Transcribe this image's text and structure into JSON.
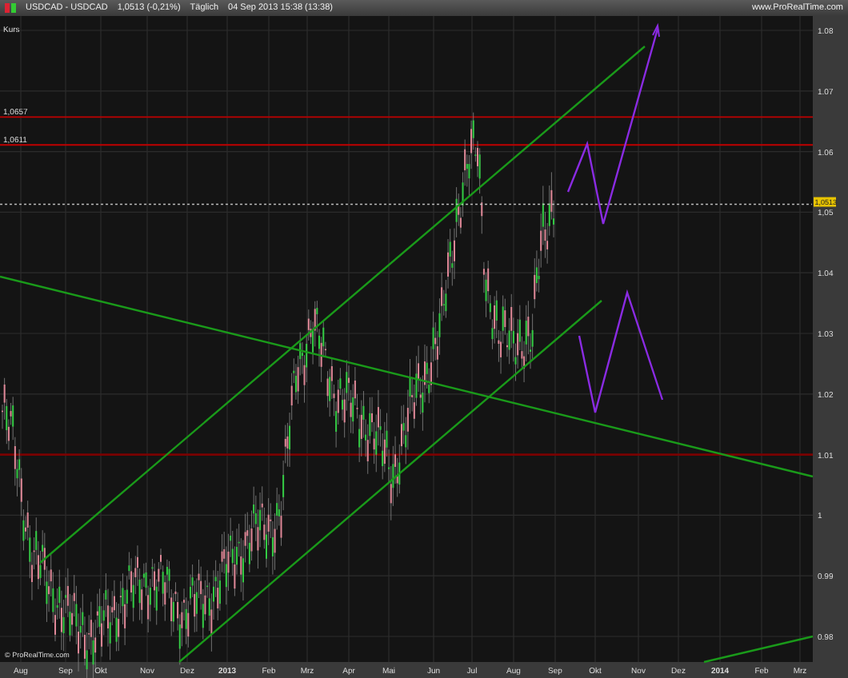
{
  "header": {
    "symbol": "USDCAD - USDCAD",
    "quote": "1,0513 (-0,21%)",
    "period": "Täglich",
    "datetime": "04 Sep 2013 15:38 (13:38)",
    "site": "www.ProRealTime.com"
  },
  "chart": {
    "unit_label": "Kurs",
    "copyright": "© ProRealTime.com",
    "price_tag": "1,0513",
    "levels": [
      {
        "label": "1,0657"
      },
      {
        "label": "1,0611"
      }
    ],
    "y_ticks": [
      {
        "label": "1.08"
      },
      {
        "label": "1.07"
      },
      {
        "label": "1.06"
      },
      {
        "label": "1,05"
      },
      {
        "label": "1.04"
      },
      {
        "label": "1.03"
      },
      {
        "label": "1.02"
      },
      {
        "label": "1.01"
      },
      {
        "label": "1"
      },
      {
        "label": "0.99"
      },
      {
        "label": "0.98"
      }
    ],
    "x_ticks": [
      {
        "label": "Aug",
        "bold": false
      },
      {
        "label": "Sep",
        "bold": false
      },
      {
        "label": "Okt",
        "bold": false
      },
      {
        "label": "Nov",
        "bold": false
      },
      {
        "label": "Dez",
        "bold": false
      },
      {
        "label": "2013",
        "bold": true
      },
      {
        "label": "Feb",
        "bold": false
      },
      {
        "label": "Mrz",
        "bold": false
      },
      {
        "label": "Apr",
        "bold": false
      },
      {
        "label": "Mai",
        "bold": false
      },
      {
        "label": "Jun",
        "bold": false
      },
      {
        "label": "Jul",
        "bold": false
      },
      {
        "label": "Aug",
        "bold": false
      },
      {
        "label": "Sep",
        "bold": false
      },
      {
        "label": "Okt",
        "bold": false
      },
      {
        "label": "Nov",
        "bold": false
      },
      {
        "label": "Dez",
        "bold": false
      },
      {
        "label": "2014",
        "bold": true
      },
      {
        "label": "Feb",
        "bold": false
      },
      {
        "label": "Mrz",
        "bold": false
      }
    ]
  }
}
